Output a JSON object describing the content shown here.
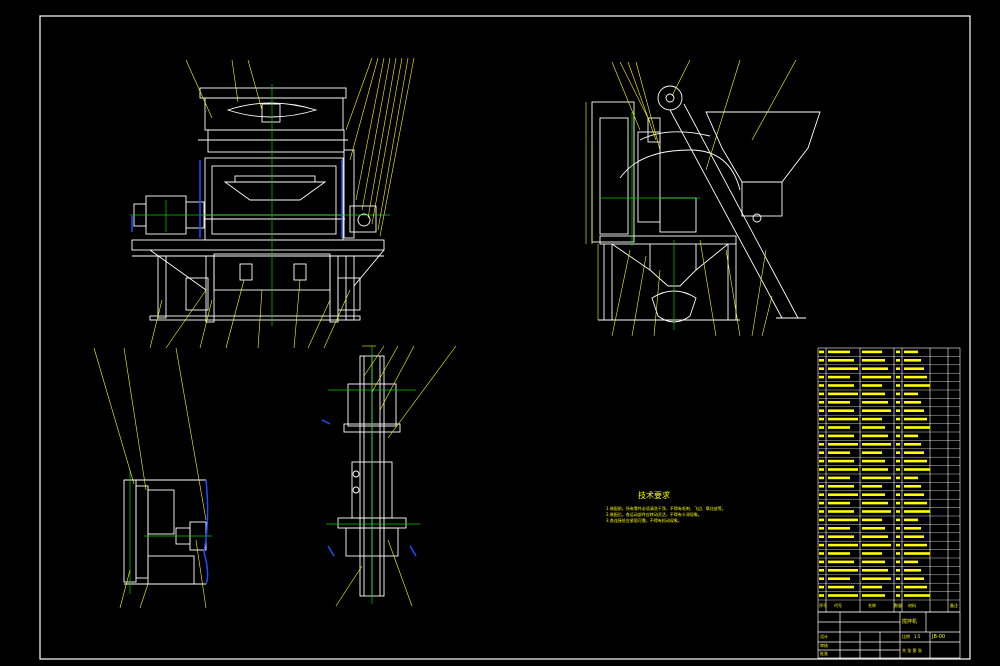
{
  "colors": {
    "background": "#000000",
    "frame": "#ffffff",
    "geometry": "#ffffff",
    "leader": "#ffff00",
    "center": "#00cc00",
    "hidden": "#1f4fff",
    "text": "#ffff00"
  },
  "technical_requirements": {
    "title": "技术要求",
    "lines": [
      "1.装配前，所有零件必须清洗干净，不得有毛刺、飞边、氧化皮等。",
      "2.装配后，各运动部件应转动灵活，不得有卡滞现象。",
      "3.各连接处应紧固可靠，不得有松动现象。"
    ]
  },
  "title_block": {
    "drawing_name": "搅拌机",
    "drawing_number": "JB-00",
    "scale_label": "比例",
    "scale": "1:5",
    "sheet_label": "共  张  第  张",
    "designer_label": "设计",
    "checker_label": "审核",
    "approver_label": "批准"
  },
  "bom_header": [
    "序号",
    "代号",
    "名称",
    "数量",
    "材料",
    "备注"
  ]
}
